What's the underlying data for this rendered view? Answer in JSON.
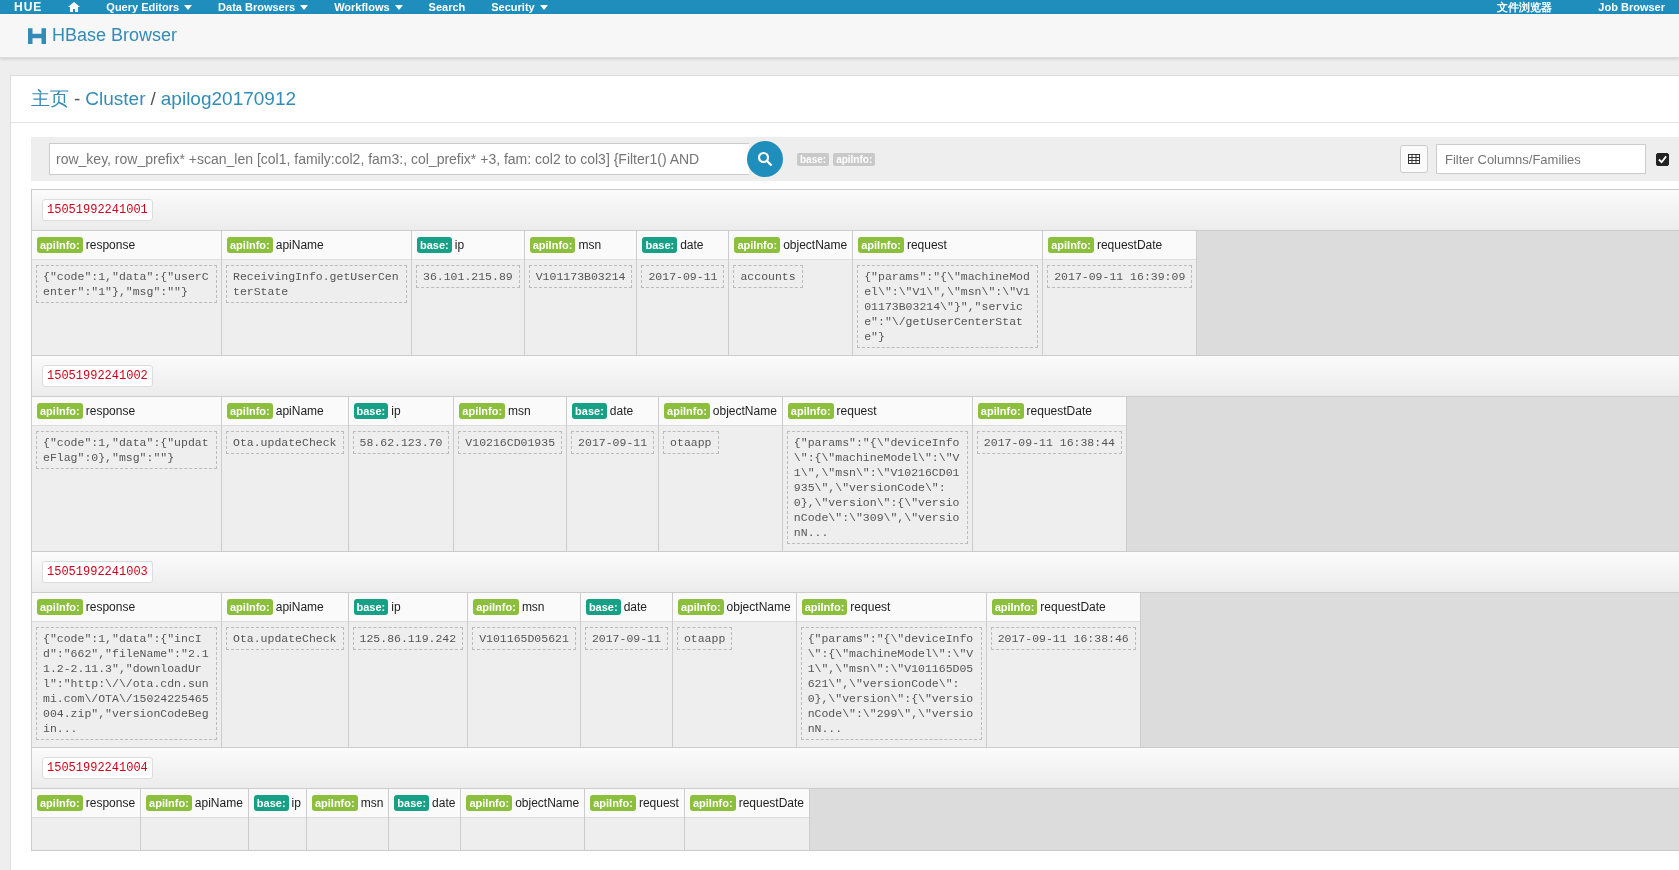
{
  "topnav": {
    "logo": "HUE",
    "items": [
      {
        "label": "Query Editors",
        "dropdown": true
      },
      {
        "label": "Data Browsers",
        "dropdown": true
      },
      {
        "label": "Workflows",
        "dropdown": true
      },
      {
        "label": "Search",
        "dropdown": false
      },
      {
        "label": "Security",
        "dropdown": true
      }
    ],
    "right_items": [
      "文件浏览器",
      "Job Browser"
    ]
  },
  "app_title": "HBase Browser",
  "breadcrumb": [
    {
      "label": "主页"
    },
    {
      "label": "Cluster",
      "sep": "-"
    },
    {
      "label": "apilog20170912",
      "sep": "/"
    }
  ],
  "search": {
    "placeholder": "row_key, row_prefix* +scan_len [col1, family:col2, fam3:, col_prefix* +3, fam: col2 to col3] {Filter1() AND",
    "families": [
      "base:",
      "apiInfo:"
    ],
    "filter_placeholder": "Filter Columns/Families",
    "checkbox_checked": true
  },
  "rows": [
    {
      "key": "15051992241001",
      "cells": [
        {
          "family": "apiInfo:",
          "color": "#8bbf3c",
          "column": "response",
          "value": "{\"code\":1,\"data\":{\"userCenter\":\"1\"},\"msg\":\"\"}"
        },
        {
          "family": "apiInfo:",
          "color": "#8bbf3c",
          "column": "apiName",
          "value": "ReceivingInfo.getUserCenterState"
        },
        {
          "family": "base:",
          "color": "#16a085",
          "column": "ip",
          "value": "36.101.215.89"
        },
        {
          "family": "apiInfo:",
          "color": "#8bbf3c",
          "column": "msn",
          "value": "V101173B03214"
        },
        {
          "family": "base:",
          "color": "#16a085",
          "column": "date",
          "value": "2017-09-11"
        },
        {
          "family": "apiInfo:",
          "color": "#8bbf3c",
          "column": "objectName",
          "value": "accounts"
        },
        {
          "family": "apiInfo:",
          "color": "#8bbf3c",
          "column": "request",
          "value": "{\"params\":\"{\\\"machineModel\\\":\\\"V1\\\",\\\"msn\\\":\\\"V101173B03214\\\"}\",\"service\":\"\\/getUserCenterState\"}"
        },
        {
          "family": "apiInfo:",
          "color": "#8bbf3c",
          "column": "requestDate",
          "value": "2017-09-11 16:39:09"
        }
      ]
    },
    {
      "key": "15051992241002",
      "cells": [
        {
          "family": "apiInfo:",
          "color": "#8bbf3c",
          "column": "response",
          "value": "{\"code\":1,\"data\":{\"updateFlag\":0},\"msg\":\"\"}"
        },
        {
          "family": "apiInfo:",
          "color": "#8bbf3c",
          "column": "apiName",
          "value": "Ota.updateCheck"
        },
        {
          "family": "base:",
          "color": "#16a085",
          "column": "ip",
          "value": "58.62.123.70"
        },
        {
          "family": "apiInfo:",
          "color": "#8bbf3c",
          "column": "msn",
          "value": "V10216CD01935"
        },
        {
          "family": "base:",
          "color": "#16a085",
          "column": "date",
          "value": "2017-09-11"
        },
        {
          "family": "apiInfo:",
          "color": "#8bbf3c",
          "column": "objectName",
          "value": "otaapp"
        },
        {
          "family": "apiInfo:",
          "color": "#8bbf3c",
          "column": "request",
          "value": "{\"params\":\"{\\\"deviceInfo\\\":{\\\"machineModel\\\":\\\"V1\\\",\\\"msn\\\":\\\"V10216CD01935\\\",\\\"versionCode\\\":0},\\\"version\\\":{\\\"versionCode\\\":\\\"309\\\",\\\"versionN..."
        },
        {
          "family": "apiInfo:",
          "color": "#8bbf3c",
          "column": "requestDate",
          "value": "2017-09-11 16:38:44"
        }
      ]
    },
    {
      "key": "15051992241003",
      "cells": [
        {
          "family": "apiInfo:",
          "color": "#8bbf3c",
          "column": "response",
          "value": "{\"code\":1,\"data\":{\"incId\":\"662\",\"fileName\":\"2.11.2-2.11.3\",\"downloadUrl\":\"http:\\/\\/ota.cdn.sunmi.com\\/OTA\\/15024225465004.zip\",\"versionCodeBegin..."
        },
        {
          "family": "apiInfo:",
          "color": "#8bbf3c",
          "column": "apiName",
          "value": "Ota.updateCheck"
        },
        {
          "family": "base:",
          "color": "#16a085",
          "column": "ip",
          "value": "125.86.119.242"
        },
        {
          "family": "apiInfo:",
          "color": "#8bbf3c",
          "column": "msn",
          "value": "V101165D05621"
        },
        {
          "family": "base:",
          "color": "#16a085",
          "column": "date",
          "value": "2017-09-11"
        },
        {
          "family": "apiInfo:",
          "color": "#8bbf3c",
          "column": "objectName",
          "value": "otaapp"
        },
        {
          "family": "apiInfo:",
          "color": "#8bbf3c",
          "column": "request",
          "value": "{\"params\":\"{\\\"deviceInfo\\\":{\\\"machineModel\\\":\\\"V1\\\",\\\"msn\\\":\\\"V101165D05621\\\",\\\"versionCode\\\":0},\\\"version\\\":{\\\"versionCode\\\":\\\"299\\\",\\\"versionN..."
        },
        {
          "family": "apiInfo:",
          "color": "#8bbf3c",
          "column": "requestDate",
          "value": "2017-09-11 16:38:46"
        }
      ]
    },
    {
      "key": "15051992241004",
      "cells": [
        {
          "family": "apiInfo:",
          "color": "#8bbf3c",
          "column": "response"
        },
        {
          "family": "apiInfo:",
          "color": "#8bbf3c",
          "column": "apiName"
        },
        {
          "family": "base:",
          "color": "#16a085",
          "column": "ip"
        },
        {
          "family": "apiInfo:",
          "color": "#8bbf3c",
          "column": "msn"
        },
        {
          "family": "base:",
          "color": "#16a085",
          "column": "date"
        },
        {
          "family": "apiInfo:",
          "color": "#8bbf3c",
          "column": "objectName"
        },
        {
          "family": "apiInfo:",
          "color": "#8bbf3c",
          "column": "request"
        },
        {
          "family": "apiInfo:",
          "color": "#8bbf3c",
          "column": "requestDate"
        }
      ]
    }
  ]
}
